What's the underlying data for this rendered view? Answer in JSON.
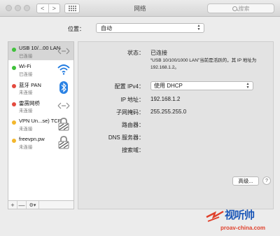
{
  "window": {
    "title": "网络",
    "search_placeholder": "搜索",
    "nav_back": "<",
    "nav_forward": ">"
  },
  "location": {
    "label": "位置：",
    "value": "自动"
  },
  "services": [
    {
      "name": "USB 10/...00 LAN",
      "status": "已连接",
      "color": "#3fc13a",
      "icon": "ethernet-icon",
      "selected": true
    },
    {
      "name": "Wi-Fi",
      "status": "已连接",
      "color": "#3fc13a",
      "icon": "wifi-icon",
      "selected": false
    },
    {
      "name": "蓝牙 PAN",
      "status": "未连接",
      "color": "#e44a3e",
      "icon": "bluetooth-icon",
      "selected": false
    },
    {
      "name": "雷雳网桥",
      "status": "未连接",
      "color": "#e44a3e",
      "icon": "thunderbolt-ethernet-icon",
      "selected": false
    },
    {
      "name": "VPN Un...se) TCP",
      "status": "未连接",
      "color": "#f3b72c",
      "icon": "vpn-lock-icon",
      "selected": false
    },
    {
      "name": "freevpn.pw",
      "status": "未连接",
      "color": "#f3b72c",
      "icon": "vpn-lock-icon",
      "selected": false
    }
  ],
  "sidebar_buttons": {
    "add": "+",
    "remove": "—",
    "gear": "⚙▾"
  },
  "detail": {
    "status_label": "状态：",
    "status_value": "已连接",
    "status_desc": "“USB 10/100/1000 LAN”当前是活跃的，其 IP 地址为 192.168.1.2。",
    "config_label": "配置 IPv4：",
    "config_value": "使用 DHCP",
    "ip_label": "IP 地址：",
    "ip_value": "192.168.1.2",
    "mask_label": "子网掩码：",
    "mask_value": "255.255.255.0",
    "router_label": "路由器：",
    "dns_label": "DNS 服务器：",
    "search_label": "搜索域：",
    "advanced_button": "高级...",
    "help_button": "?"
  },
  "watermark": {
    "text": "视听帅",
    "url": "proav-china.com"
  }
}
